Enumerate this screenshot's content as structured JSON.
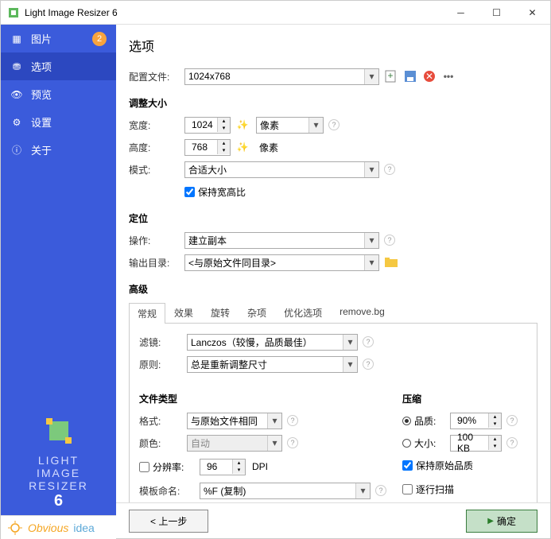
{
  "app": {
    "title": "Light Image Resizer 6"
  },
  "sidebar": {
    "items": [
      {
        "label": "图片",
        "badge": "2"
      },
      {
        "label": "选项"
      },
      {
        "label": "预览"
      },
      {
        "label": "设置"
      },
      {
        "label": "关于"
      }
    ],
    "logo": {
      "l1": "LIGHT",
      "l2": "IMAGE",
      "l3": "RESIZER",
      "l4": "6"
    }
  },
  "page": {
    "title": "选项",
    "profile_label": "配置文件:",
    "profile_value": "1024x768",
    "resize_title": "调整大小",
    "width_label": "宽度:",
    "width_value": "1024",
    "unit_label": "像素",
    "height_label": "高度:",
    "height_value": "768",
    "mode_label": "模式:",
    "mode_value": "合适大小",
    "keep_ratio": "保持宽高比",
    "pos_title": "定位",
    "action_label": "操作:",
    "action_value": "建立副本",
    "outdir_label": "输出目录:",
    "outdir_value": "<与原始文件同目录>",
    "adv_title": "高级",
    "tabs": [
      "常规",
      "效果",
      "旋转",
      "杂项",
      "优化选项",
      "remove.bg"
    ],
    "filter_label": "滤镜:",
    "filter_value": "Lanczos（较慢，品质最佳）",
    "policy_label": "原则:",
    "policy_value": "总是重新调整尺寸",
    "filetype_title": "文件类型",
    "format_label": "格式:",
    "format_value": "与原始文件相同",
    "color_label": "颜色:",
    "color_value": "自动",
    "res_cb": "分辨率:",
    "res_value": "96",
    "dpi": "DPI",
    "tmpl_label": "模板命名:",
    "tmpl_value": "%F (复制)",
    "comp_title": "压缩",
    "quality_label": "品质:",
    "quality_value": "90%",
    "size_label": "大小:",
    "size_value": "100 KB",
    "keep_orig_quality": "保持原始品质",
    "prog_scan": "逐行扫描"
  },
  "buttons": {
    "prev": "< 上一步",
    "ok": "确定"
  },
  "footer": {
    "obvious": "Obvious",
    "idea": "idea"
  }
}
